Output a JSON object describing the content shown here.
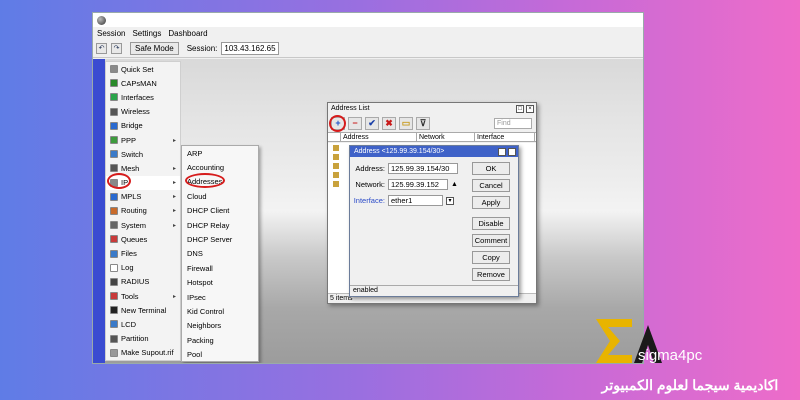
{
  "app": {
    "menu": [
      "Session",
      "Settings",
      "Dashboard"
    ],
    "toolbar": {
      "undo": "↶",
      "redo": "↷",
      "safe_mode": "Safe Mode",
      "session_label": "Session:",
      "session_value": "103.43.162.65"
    }
  },
  "sidebar": {
    "items": [
      {
        "label": "Quick Set",
        "icon": "quickset-icon",
        "color": "#8a8a8a"
      },
      {
        "label": "CAPsMAN",
        "icon": "capsman-icon",
        "color": "#2a8a2a"
      },
      {
        "label": "Interfaces",
        "icon": "interfaces-icon",
        "color": "#2aa44a"
      },
      {
        "label": "Wireless",
        "icon": "wireless-icon",
        "color": "#555555"
      },
      {
        "label": "Bridge",
        "icon": "bridge-icon",
        "color": "#2a6ad0"
      },
      {
        "label": "PPP",
        "icon": "ppp-icon",
        "color": "#3c9a3c"
      },
      {
        "label": "Switch",
        "icon": "switch-icon",
        "color": "#3a7ac8"
      },
      {
        "label": "Mesh",
        "icon": "mesh-icon",
        "color": "#555555"
      },
      {
        "label": "IP",
        "icon": "ip-icon",
        "color": "#888888"
      },
      {
        "label": "MPLS",
        "icon": "mpls-icon",
        "color": "#2a6ad0"
      },
      {
        "label": "Routing",
        "icon": "routing-icon",
        "color": "#c86a2a"
      },
      {
        "label": "System",
        "icon": "system-icon",
        "color": "#666666"
      },
      {
        "label": "Queues",
        "icon": "queues-icon",
        "color": "#c83a3a"
      },
      {
        "label": "Files",
        "icon": "files-icon",
        "color": "#3a7ac8"
      },
      {
        "label": "Log",
        "icon": "log-icon",
        "color": "#ffffff"
      },
      {
        "label": "RADIUS",
        "icon": "radius-icon",
        "color": "#444444"
      },
      {
        "label": "Tools",
        "icon": "tools-icon",
        "color": "#c83a3a"
      },
      {
        "label": "New Terminal",
        "icon": "terminal-icon",
        "color": "#222222"
      },
      {
        "label": "LCD",
        "icon": "lcd-icon",
        "color": "#3a7ac8"
      },
      {
        "label": "Partition",
        "icon": "partition-icon",
        "color": "#555555"
      },
      {
        "label": "Make Supout.rif",
        "icon": "supout-icon",
        "color": "#999999"
      }
    ],
    "submenu_arrow": "▸"
  },
  "ip_submenu": [
    "ARP",
    "Accounting",
    "Addresses",
    "Cloud",
    "DHCP Client",
    "DHCP Relay",
    "DHCP Server",
    "DNS",
    "Firewall",
    "Hotspot",
    "IPsec",
    "Kid Control",
    "Neighbors",
    "Packing",
    "Pool",
    "Routes"
  ],
  "address_list": {
    "title": "Address List",
    "find_placeholder": "Find",
    "columns": [
      "Address",
      "Network",
      "Interface"
    ],
    "status": "5 items",
    "toolbar": {
      "add": "+",
      "remove": "−",
      "enable": "✔",
      "disable": "✖",
      "comment": "▭",
      "filter": "⊽"
    }
  },
  "address_dialog": {
    "title": "Address <125.99.39.154/30>",
    "fields": {
      "address_label": "Address:",
      "address_value": "125.99.39.154/30",
      "network_label": "Network:",
      "network_value": "125.99.39.152",
      "interface_label": "Interface:",
      "interface_value": "ether1"
    },
    "buttons": [
      "OK",
      "Cancel",
      "Apply",
      "Disable",
      "Comment",
      "Copy",
      "Remove"
    ],
    "status": "enabled"
  },
  "branding": {
    "name": "sigma4pc",
    "arabic": "اكاديمية سيجما لعلوم الكمبيوتر",
    "colors": {
      "accent": "#e8b400",
      "highlight": "#d61c1c"
    }
  }
}
